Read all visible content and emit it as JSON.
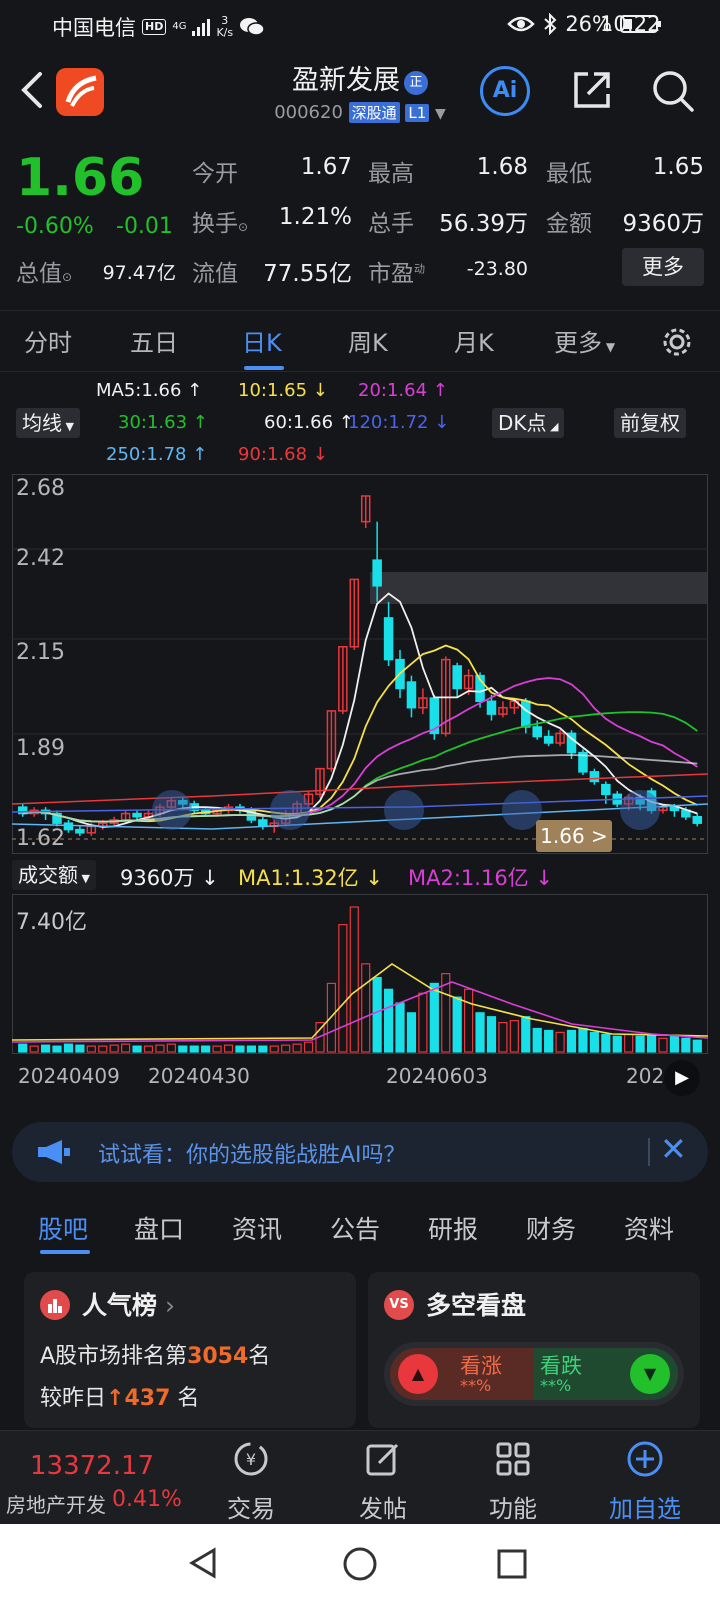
{
  "status_bar": {
    "carrier": "中国电信",
    "hd": "HD",
    "net": "4G",
    "speed_value": "3",
    "speed_unit": "K/s",
    "battery": "26%",
    "time": "10:22"
  },
  "header": {
    "title": "盈新发展",
    "badge": "正",
    "code": "000620",
    "tag": "深股通",
    "level": "L1",
    "ai_label": "Ai"
  },
  "quote": {
    "price": "1.66",
    "pct_change": "-0.60%",
    "abs_change": "-0.01",
    "open_label": "今开",
    "open": "1.67",
    "high_label": "最高",
    "high": "1.68",
    "low_label": "最低",
    "low": "1.65",
    "turnover_label": "换手",
    "turnover": "1.21%",
    "volume_label": "总手",
    "volume": "56.39万",
    "amount_label": "金额",
    "amount": "9360万",
    "mktcap_label": "总值",
    "mktcap": "97.47亿",
    "float_label": "流值",
    "float": "77.55亿",
    "pe_label": "市盈",
    "pe_sup": "动",
    "pe": "-23.80",
    "more": "更多"
  },
  "tabs": [
    "分时",
    "五日",
    "日K",
    "周K",
    "月K",
    "更多"
  ],
  "ma": {
    "ma5": "MA5:1.66",
    "ma10": "10:1.65",
    "ma20": "20:1.64",
    "ma30": "30:1.63",
    "ma60": "60:1.66",
    "ma120": "120:1.72",
    "ma250": "250:1.78",
    "ma90": "90:1.68",
    "avg_btn": "均线",
    "dk_btn": "DK点",
    "adj_btn": "前复权"
  },
  "chart_axis": {
    "y1": "2.68",
    "y2": "2.42",
    "y3": "2.15",
    "y4": "1.89",
    "y5": "1.62",
    "cur_price": "1.66 >"
  },
  "volume": {
    "label": "成交额",
    "value": "9360万",
    "ma1": "MA1:1.32亿",
    "ma2": "MA2:1.16亿",
    "ymax": "7.40亿",
    "dates": [
      "20240409",
      "20240430",
      "20240603",
      "202"
    ]
  },
  "chart_data": {
    "type": "candlestick",
    "y_ticks": [
      2.68,
      2.42,
      2.15,
      1.89,
      1.62
    ],
    "x_ticks": [
      "20240409",
      "20240430",
      "20240603"
    ],
    "volume_ymax": "7.40亿"
  },
  "banner": {
    "text": "试试看：你的选股能战胜AI吗？"
  },
  "section_tabs": [
    "股吧",
    "盘口",
    "资讯",
    "公告",
    "研报",
    "财务",
    "资料"
  ],
  "cards": {
    "popular_title": "人气榜",
    "rank_prefix": "A股市场排名第",
    "rank": "3054",
    "rank_suffix": "名",
    "change_prefix": "较昨日",
    "change": "437",
    "change_suffix": "名",
    "vs_title": "多空看盘",
    "bull": "看涨",
    "bear": "看跌",
    "bull_pct": "**%",
    "bear_pct": "**%"
  },
  "bottom": {
    "index_value": "13372.17",
    "index_name": "房地产开发",
    "index_pct": "0.41%",
    "trade": "交易",
    "post": "发帖",
    "func": "功能",
    "add": "加自选"
  },
  "colors": {
    "up": "#e8383d",
    "down": "#22c02b",
    "accent": "#4a8ff5"
  }
}
